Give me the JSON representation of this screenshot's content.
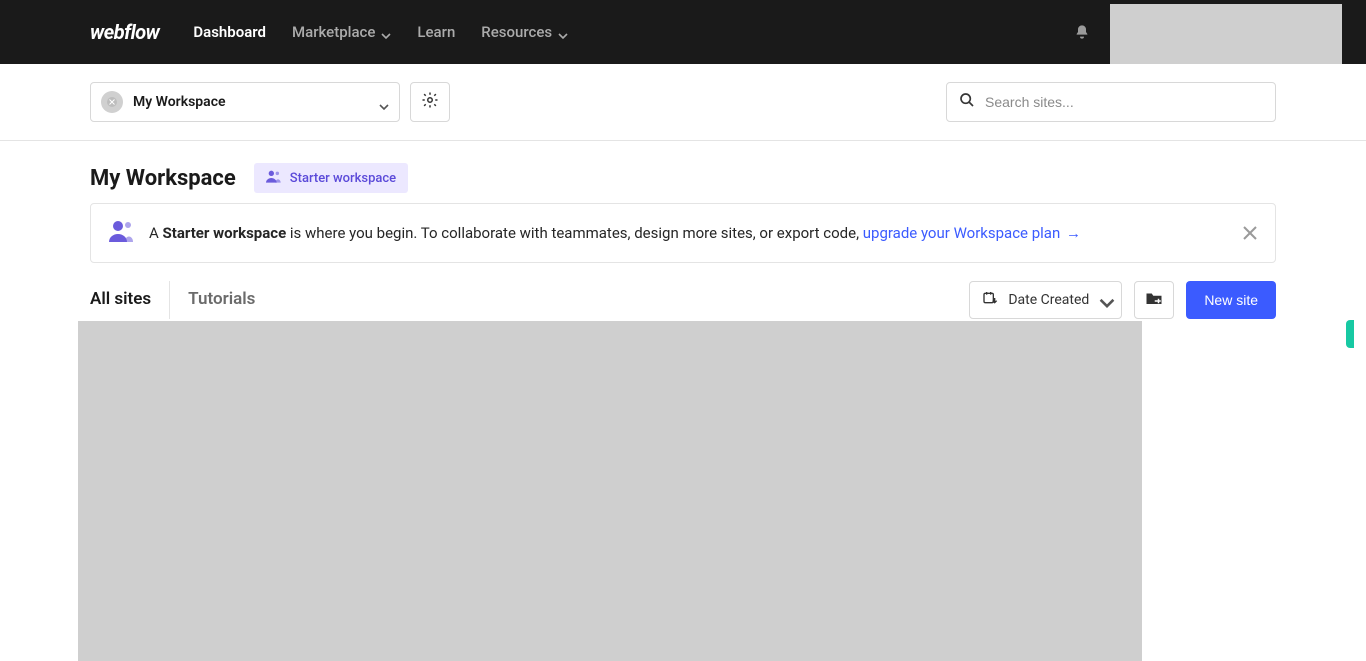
{
  "brand": "webflow",
  "nav": {
    "dashboard": "Dashboard",
    "marketplace": "Marketplace",
    "learn": "Learn",
    "resources": "Resources"
  },
  "workspace_selector": {
    "name": "My Workspace"
  },
  "search": {
    "placeholder": "Search sites..."
  },
  "header": {
    "title": "My Workspace",
    "plan_badge": "Starter workspace"
  },
  "notice": {
    "prefix": "A ",
    "strong": "Starter workspace",
    "rest": " is where you begin. To collaborate with teammates, design more sites, or export code, ",
    "link": "upgrade your Workspace plan"
  },
  "tabs": {
    "all_sites": "All sites",
    "tutorials": "Tutorials"
  },
  "actions": {
    "sort_label": "Date Created",
    "new_site": "New site"
  }
}
